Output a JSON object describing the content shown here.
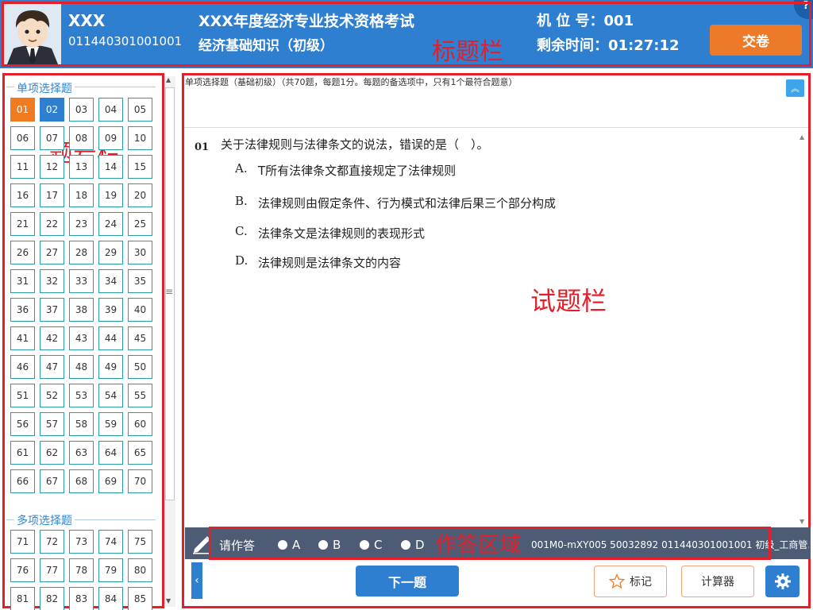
{
  "header": {
    "candidate_name": "XXX",
    "candidate_id": "011440301001001",
    "exam_title": "XXX年度经济专业技术资格考试",
    "exam_subject": "经济基础知识（初级）",
    "seat_label": "机 位 号：001",
    "timer_label": "剩余时间：01:27:12",
    "submit_label": "交卷",
    "help_label": "?",
    "annotation": "标题栏"
  },
  "sidebar": {
    "section_single_title": "单项选择题",
    "section_multi_title": "多项选择题",
    "annotation": "题号栏",
    "single_questions": [
      "01",
      "02",
      "03",
      "04",
      "05",
      "06",
      "07",
      "08",
      "09",
      "10",
      "11",
      "12",
      "13",
      "14",
      "15",
      "16",
      "17",
      "18",
      "19",
      "20",
      "21",
      "22",
      "23",
      "24",
      "25",
      "26",
      "27",
      "28",
      "29",
      "30",
      "31",
      "32",
      "33",
      "34",
      "35",
      "36",
      "37",
      "38",
      "39",
      "40",
      "41",
      "42",
      "43",
      "44",
      "45",
      "46",
      "47",
      "48",
      "49",
      "50",
      "51",
      "52",
      "53",
      "54",
      "55",
      "56",
      "57",
      "58",
      "59",
      "60",
      "61",
      "62",
      "63",
      "64",
      "65",
      "66",
      "67",
      "68",
      "69",
      "70"
    ],
    "multi_questions": [
      "71",
      "72",
      "73",
      "74",
      "75",
      "76",
      "77",
      "78",
      "79",
      "80",
      "81",
      "82",
      "83",
      "84",
      "85"
    ],
    "current_question": "01",
    "viewed_question": "02"
  },
  "question_area": {
    "instructions": "单项选择题（基础初级）（共70题，每题1分。每题的备选项中，只有1个最符合题意）",
    "number": "01",
    "stem": "关于法律规则与法律条文的说法，错误的是（　）。",
    "options": [
      {
        "letter": "A.",
        "text": "T所有法律条文都直接规定了法律规则"
      },
      {
        "letter": "B.",
        "text": "法律规则由假定条件、行为模式和法律后果三个部分构成"
      },
      {
        "letter": "C.",
        "text": "法律条文是法律规则的表现形式"
      },
      {
        "letter": "D.",
        "text": "法律规则是法律条文的内容"
      }
    ],
    "annotation": "试题栏"
  },
  "answer_bar": {
    "prompt": "请作答",
    "choices": [
      "A",
      "B",
      "C",
      "D"
    ],
    "meta": "001M0-mXY005  50032892 011440301001001 初级_工商管...",
    "annotation": "作答区域"
  },
  "bottom": {
    "prev_label": "‹",
    "next_label": "下一题",
    "mark_label": "标记",
    "calc_label": "计算器"
  },
  "colors": {
    "brand_blue": "#2f7fd1",
    "accent_orange": "#ec7a28",
    "annotation_red": "#e41f2a"
  }
}
